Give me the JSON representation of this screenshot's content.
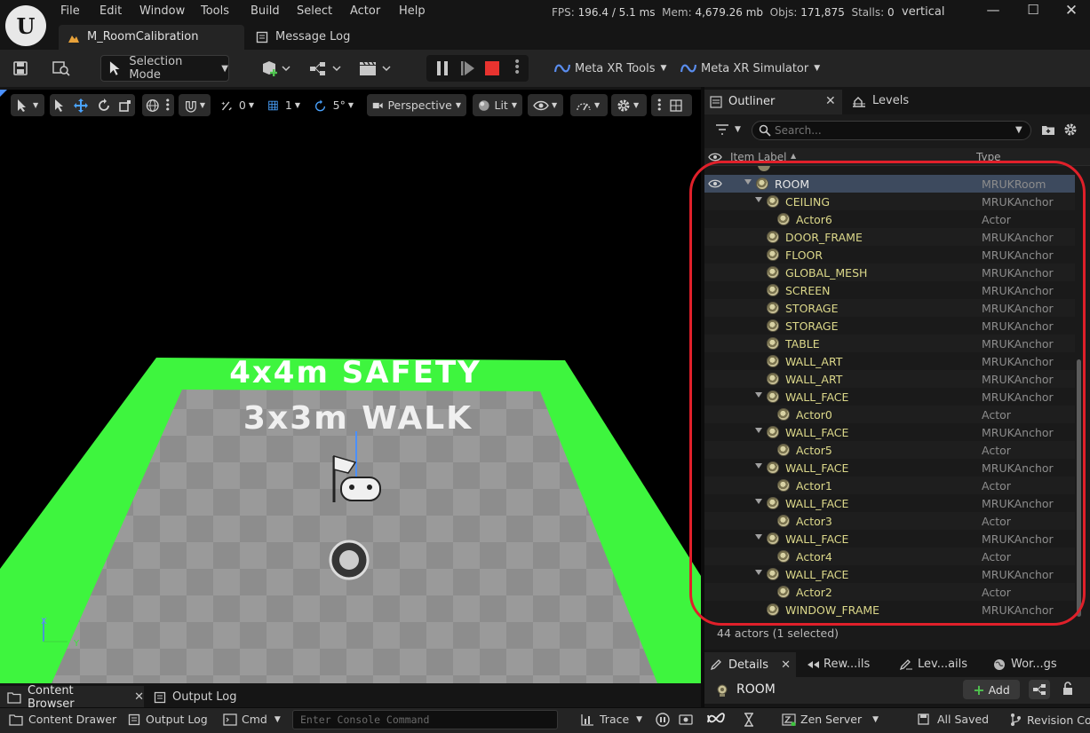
{
  "menubar": {
    "items": [
      "File",
      "Edit",
      "Window",
      "Tools",
      "Build",
      "Select",
      "Actor",
      "Help"
    ],
    "stats": {
      "fps_label": "FPS:",
      "fps": "196.4",
      "frame": "/ 5.1 ms",
      "mem_label": "Mem:",
      "mem": "4,679.26 mb",
      "objs_label": "Objs:",
      "objs": "171,875",
      "stalls_label": "Stalls:",
      "stalls": "0"
    },
    "project": "vertical"
  },
  "tabs": {
    "level_tab": "M_RoomCalibration",
    "message_log": "Message Log"
  },
  "toolbar": {
    "selection_mode": "Selection Mode",
    "meta_xr_tools": "Meta XR Tools",
    "meta_xr_simulator": "Meta XR Simulator"
  },
  "viewport": {
    "perspective": "Perspective",
    "lit": "Lit",
    "translate_snap": "0",
    "grid_snap": "1",
    "rotate_snap": "5°",
    "scene_text_outer": "4x4m SAFETY",
    "scene_text_inner": "3x3m WALK",
    "axis_x": "X",
    "axis_y": "Y"
  },
  "outliner": {
    "tab_label": "Outliner",
    "levels_tab": "Levels",
    "search_placeholder": "Search...",
    "col_label": "Item Label",
    "col_type": "Type",
    "rows": [
      {
        "name": "ROOM",
        "type": "MRUKRoom",
        "indent": 0,
        "expanded": true,
        "selected": true
      },
      {
        "name": "CEILING",
        "type": "MRUKAnchor",
        "indent": 1,
        "expanded": true
      },
      {
        "name": "Actor6",
        "type": "Actor",
        "indent": 2
      },
      {
        "name": "DOOR_FRAME",
        "type": "MRUKAnchor",
        "indent": 1
      },
      {
        "name": "FLOOR",
        "type": "MRUKAnchor",
        "indent": 1
      },
      {
        "name": "GLOBAL_MESH",
        "type": "MRUKAnchor",
        "indent": 1
      },
      {
        "name": "SCREEN",
        "type": "MRUKAnchor",
        "indent": 1
      },
      {
        "name": "STORAGE",
        "type": "MRUKAnchor",
        "indent": 1
      },
      {
        "name": "STORAGE",
        "type": "MRUKAnchor",
        "indent": 1
      },
      {
        "name": "TABLE",
        "type": "MRUKAnchor",
        "indent": 1
      },
      {
        "name": "WALL_ART",
        "type": "MRUKAnchor",
        "indent": 1
      },
      {
        "name": "WALL_ART",
        "type": "MRUKAnchor",
        "indent": 1
      },
      {
        "name": "WALL_FACE",
        "type": "MRUKAnchor",
        "indent": 1,
        "expanded": true
      },
      {
        "name": "Actor0",
        "type": "Actor",
        "indent": 2
      },
      {
        "name": "WALL_FACE",
        "type": "MRUKAnchor",
        "indent": 1,
        "expanded": true
      },
      {
        "name": "Actor5",
        "type": "Actor",
        "indent": 2
      },
      {
        "name": "WALL_FACE",
        "type": "MRUKAnchor",
        "indent": 1,
        "expanded": true
      },
      {
        "name": "Actor1",
        "type": "Actor",
        "indent": 2
      },
      {
        "name": "WALL_FACE",
        "type": "MRUKAnchor",
        "indent": 1,
        "expanded": true
      },
      {
        "name": "Actor3",
        "type": "Actor",
        "indent": 2
      },
      {
        "name": "WALL_FACE",
        "type": "MRUKAnchor",
        "indent": 1,
        "expanded": true
      },
      {
        "name": "Actor4",
        "type": "Actor",
        "indent": 2
      },
      {
        "name": "WALL_FACE",
        "type": "MRUKAnchor",
        "indent": 1,
        "expanded": true
      },
      {
        "name": "Actor2",
        "type": "Actor",
        "indent": 2
      },
      {
        "name": "WINDOW_FRAME",
        "type": "MRUKAnchor",
        "indent": 1
      }
    ],
    "footer": "44 actors (1 selected)"
  },
  "details": {
    "tabs": [
      "Details",
      "Rew...ils",
      "Lev...ails",
      "Wor...gs"
    ],
    "object_name": "ROOM",
    "add_label": "Add"
  },
  "bottom": {
    "content_browser": "Content Browser",
    "output_log_tab": "Output Log",
    "content_drawer": "Content Drawer",
    "output_log": "Output Log",
    "cmd": "Cmd",
    "console_placeholder": "Enter Console Command",
    "trace": "Trace",
    "zen_server": "Zen Server",
    "all_saved": "All Saved",
    "revision_control": "Revision Control"
  },
  "colors": {
    "accent_green": "#3ef53e",
    "highlight_red": "#e0202a",
    "anchor_text": "#dcd88a",
    "selected_row": "#3d4a5e"
  }
}
